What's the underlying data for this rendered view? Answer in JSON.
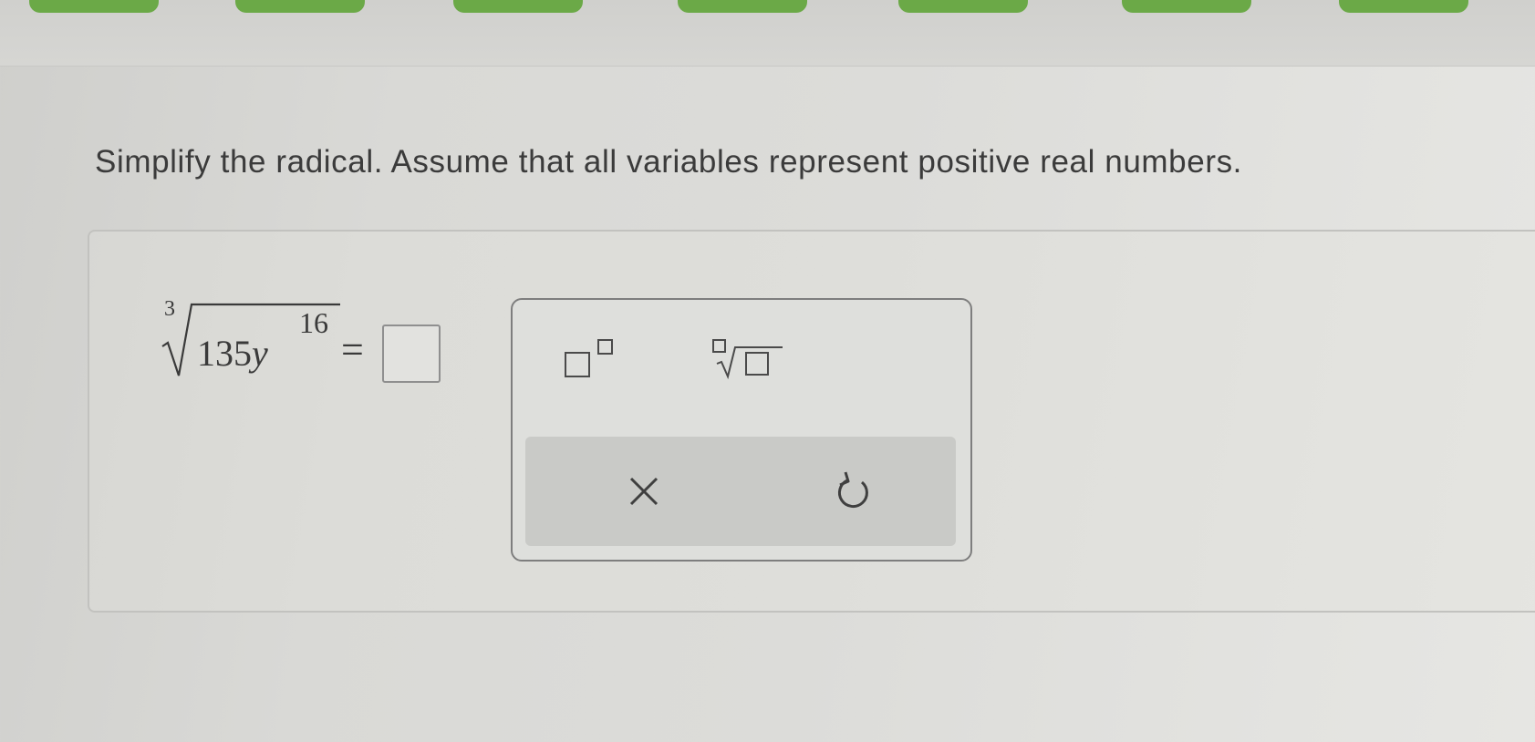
{
  "question": {
    "prompt": "Simplify the radical. Assume that all variables represent positive real numbers."
  },
  "expression": {
    "index": "3",
    "coefficient": "135",
    "variable": "y",
    "exponent": "16",
    "equals": "="
  },
  "answer": {
    "value": ""
  },
  "keypad": {
    "buttons": [
      {
        "name": "exponent",
        "icon": "superscript-template-icon"
      },
      {
        "name": "nth-root",
        "icon": "nth-root-template-icon"
      }
    ],
    "actions": [
      {
        "name": "clear",
        "icon": "close-icon"
      },
      {
        "name": "undo",
        "icon": "undo-icon"
      }
    ]
  },
  "colors": {
    "tab_green": "#6ba947",
    "text": "#3a3a3a",
    "keypad_border": "#7e7e7e",
    "action_bar": "#c9cac7"
  }
}
